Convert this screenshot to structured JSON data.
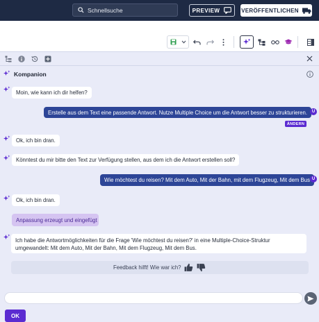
{
  "topbar": {
    "search_placeholder": "Schnellsuche",
    "preview_label": "PREVIEW",
    "publish_label": "VERÖFFENTLICHEN"
  },
  "toolbar": {
    "icons": [
      "save-icon",
      "chevron-down-icon",
      "undo-icon",
      "redo-icon",
      "more-vertical-icon",
      "sparkle-icon",
      "structure-icon",
      "glasses-icon",
      "graduation-cap-icon",
      "panel-layout-icon"
    ]
  },
  "panel": {
    "top_icons": [
      "tree-icon",
      "info-icon",
      "history-icon",
      "add-icon",
      "close-icon"
    ],
    "title": "Kompanion"
  },
  "chat": {
    "messages": [
      {
        "role": "assistant",
        "text": "Moin, wie kann ich dir helfen?"
      },
      {
        "role": "user",
        "text": "Erstelle aus dem Text eine passende Antwort. Nutze Multiple Choice um die Antwort besser zu strukturieren."
      },
      {
        "role": "assistant",
        "text": "Ok, ich bin dran."
      },
      {
        "role": "assistant",
        "text": "Könntest du mir bitte den Text zur Verfügung stellen, aus dem ich die Antwort erstellen soll?"
      },
      {
        "role": "user",
        "text": "Wie möchtest du reisen? Mit dem Auto, Mit der Bahn, mit dem Flugzeug, Mit dem Bus"
      },
      {
        "role": "assistant",
        "text": "Ok, ich bin dran."
      },
      {
        "role": "assistant",
        "text": "Ich habe die Antwortmöglichkeiten für die Frage 'Wie möchtest du reisen?' in eine Multiple-Choice-Struktur umgewandelt: Mit dem Auto, Mit der Bahn, Mit dem Flugzeug, Mit dem Bus."
      }
    ],
    "user_initial": "U",
    "edit_label": "ÄNDERN",
    "applied_label": "Anpassung erzeugt und eingefügt",
    "feedback_text": "Feedback hilft! Wie war ich?",
    "input_value": "",
    "ok_label": "OK"
  },
  "colors": {
    "topbar": "#1e2a44",
    "accent": "#5b2bd1",
    "user_bubble": "#2d4597",
    "panel_bg": "#e9ebf8",
    "save_green": "#2e9e4f"
  }
}
